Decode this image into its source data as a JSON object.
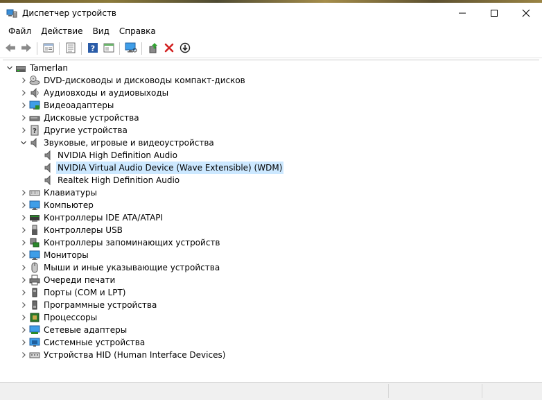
{
  "window": {
    "title": "Диспетчер устройств",
    "controls": [
      "minimize",
      "maximize",
      "close"
    ]
  },
  "menu": [
    {
      "label": "Файл"
    },
    {
      "label": "Действие"
    },
    {
      "label": "Вид"
    },
    {
      "label": "Справка"
    }
  ],
  "toolbar": [
    "back-arrow-icon",
    "forward-arrow-icon",
    "properties-icon",
    "update-list-icon",
    "help-icon",
    "view-icon",
    "monitor-icon",
    "add-driver-icon",
    "delete-icon",
    "download-icon"
  ],
  "tree": {
    "root": {
      "label": "Tamerlan",
      "expanded": true
    },
    "items": [
      {
        "label": "DVD-дисководы и дисководы компакт-дисков",
        "icon": "dvd-icon",
        "expanded": false
      },
      {
        "label": "Аудиовходы и аудиовыходы",
        "icon": "audio-icon",
        "expanded": false
      },
      {
        "label": "Видеоадаптеры",
        "icon": "display-adapter-icon",
        "expanded": false
      },
      {
        "label": "Дисковые устройства",
        "icon": "disk-icon",
        "expanded": false
      },
      {
        "label": "Другие устройства",
        "icon": "other-device-icon",
        "expanded": false
      },
      {
        "label": "Звуковые, игровые и видеоустройства",
        "icon": "speaker-icon",
        "expanded": true,
        "children": [
          {
            "label": "NVIDIA High Definition Audio",
            "icon": "speaker-icon"
          },
          {
            "label": "NVIDIA Virtual Audio Device (Wave Extensible) (WDM)",
            "icon": "speaker-icon",
            "selected": true
          },
          {
            "label": "Realtek High Definition Audio",
            "icon": "speaker-icon"
          }
        ]
      },
      {
        "label": "Клавиатуры",
        "icon": "keyboard-icon",
        "expanded": false
      },
      {
        "label": "Компьютер",
        "icon": "computer-icon",
        "expanded": false
      },
      {
        "label": "Контроллеры IDE ATA/ATAPI",
        "icon": "ide-icon",
        "expanded": false
      },
      {
        "label": "Контроллеры USB",
        "icon": "usb-icon",
        "expanded": false
      },
      {
        "label": "Контроллеры запоминающих устройств",
        "icon": "storage-controller-icon",
        "expanded": false
      },
      {
        "label": "Мониторы",
        "icon": "monitor-icon",
        "expanded": false
      },
      {
        "label": "Мыши и иные указывающие устройства",
        "icon": "mouse-icon",
        "expanded": false
      },
      {
        "label": "Очереди печати",
        "icon": "printer-icon",
        "expanded": false
      },
      {
        "label": "Порты (COM и LPT)",
        "icon": "port-icon",
        "expanded": false
      },
      {
        "label": "Программные устройства",
        "icon": "software-device-icon",
        "expanded": false
      },
      {
        "label": "Процессоры",
        "icon": "processor-icon",
        "expanded": false
      },
      {
        "label": "Сетевые адаптеры",
        "icon": "network-icon",
        "expanded": false
      },
      {
        "label": "Системные устройства",
        "icon": "system-icon",
        "expanded": false
      },
      {
        "label": "Устройства HID (Human Interface Devices)",
        "icon": "hid-icon",
        "expanded": false
      }
    ]
  },
  "colors": {
    "selection": "#cce8ff",
    "status_bar": "#f0f0f0"
  }
}
